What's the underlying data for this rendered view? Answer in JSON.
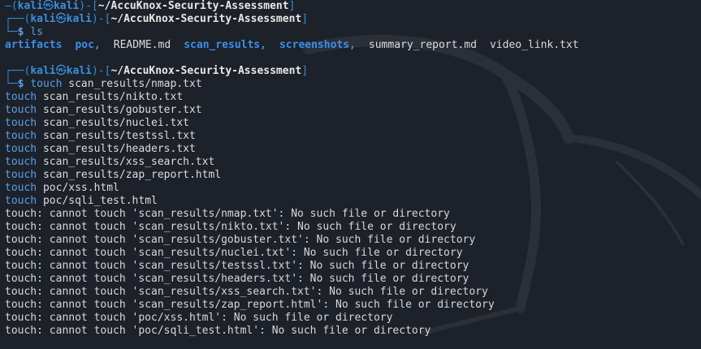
{
  "prompt": {
    "frame_top": "┌──(",
    "user": "kali",
    "skull": "㉿",
    "host": "kali",
    "mid": ")-[",
    "path": "~/AccuKnox-Security-Assessment",
    "end": "]",
    "frame_bottom": "└─",
    "dollar": "$"
  },
  "empty_prompt": {
    "frame_top": "—(",
    "dollar": "$"
  },
  "commands": {
    "ls": "ls",
    "touch_cmd": "touch",
    "touch_arg": "scan_results/nmap.txt"
  },
  "ls_output": [
    {
      "name": "artifacts",
      "type": "dir"
    },
    {
      "name": "poc,",
      "type": "dir"
    },
    {
      "name": "README.md",
      "type": "file"
    },
    {
      "name": "scan_results,",
      "type": "dir"
    },
    {
      "name": "screenshots,",
      "type": "dir"
    },
    {
      "name": "summary_report.md",
      "type": "file"
    },
    {
      "name": "video_link.txt",
      "type": "file"
    }
  ],
  "touch_lines": [
    {
      "cmd": "touch",
      "arg": "scan_results/nikto.txt"
    },
    {
      "cmd": "touch",
      "arg": "scan_results/gobuster.txt"
    },
    {
      "cmd": "touch",
      "arg": "scan_results/nuclei.txt"
    },
    {
      "cmd": "touch",
      "arg": "scan_results/testssl.txt"
    },
    {
      "cmd": "touch",
      "arg": "scan_results/headers.txt"
    },
    {
      "cmd": "touch",
      "arg": "scan_results/xss_search.txt"
    },
    {
      "cmd": "touch",
      "arg": "scan_results/zap_report.html"
    },
    {
      "cmd": "touch",
      "arg": "poc/xss.html"
    },
    {
      "cmd": "touch",
      "arg": "poc/sqli_test.html"
    }
  ],
  "errors": [
    "touch: cannot touch 'scan_results/nmap.txt': No such file or directory",
    "touch: cannot touch 'scan_results/nikto.txt': No such file or directory",
    "touch: cannot touch 'scan_results/gobuster.txt': No such file or directory",
    "touch: cannot touch 'scan_results/nuclei.txt': No such file or directory",
    "touch: cannot touch 'scan_results/testssl.txt': No such file or directory",
    "touch: cannot touch 'scan_results/headers.txt': No such file or directory",
    "touch: cannot touch 'scan_results/xss_search.txt': No such file or directory",
    "touch: cannot touch 'scan_results/zap_report.html': No such file or directory",
    "touch: cannot touch 'poc/xss.html': No such file or directory",
    "touch: cannot touch 'poc/sqli_test.html': No such file or directory"
  ],
  "colors": {
    "background": "#1d2129",
    "prompt_frame": "#2f8fd6",
    "directory": "#3a8fe8",
    "command": "#5aa0ea",
    "text": "#dcdcdc"
  },
  "icons": {
    "background_watermark": "kali-dragon-icon"
  }
}
